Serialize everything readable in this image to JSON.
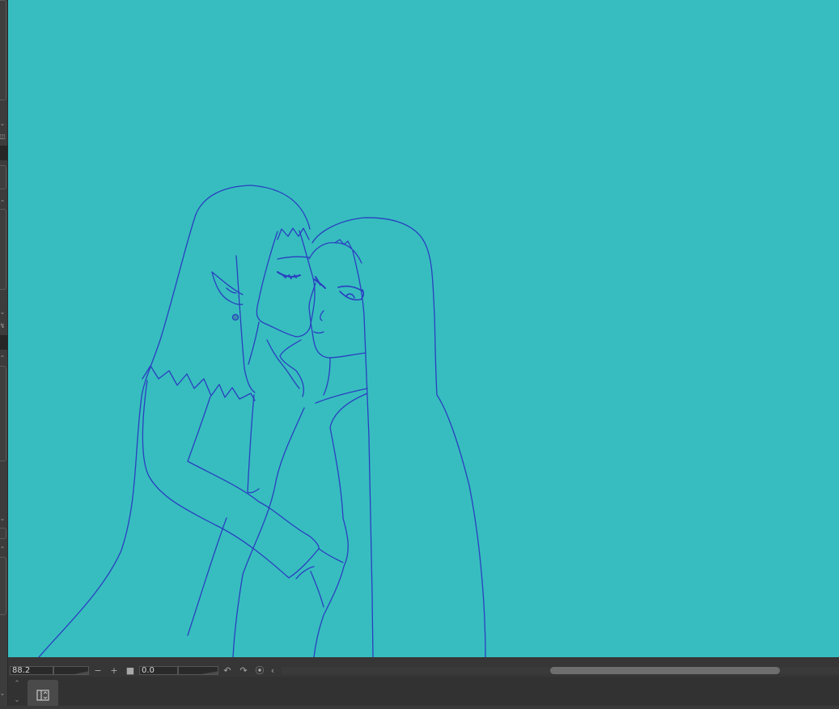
{
  "canvas": {
    "background_color": "#37bdc0",
    "line_color": "#2a3fbf",
    "content": "line-art drawing of two figures"
  },
  "status_bar": {
    "zoom_value": "88.2",
    "rotation_value": "0.0",
    "icons": [
      "minus-icon",
      "plus-icon",
      "stop-icon",
      "rotate-left-icon",
      "rotate-right-icon",
      "reset-icon",
      "chevron-left-icon"
    ]
  },
  "bottom_panel": {
    "tab_icon": "panel-toggle-icon"
  },
  "colors": {
    "panel_bg": "#3a3a3a",
    "canvas_bg": "#37bdc0",
    "scroll_thumb": "#6e6e6e"
  }
}
